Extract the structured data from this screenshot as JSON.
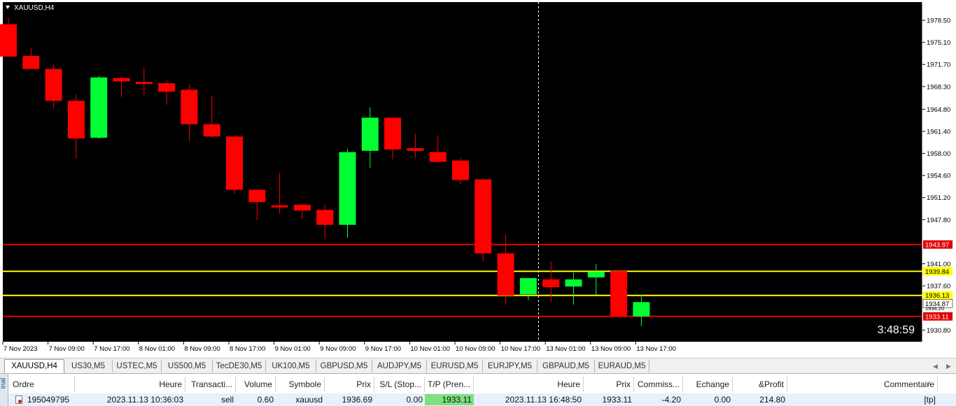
{
  "window": {
    "symbol_title": "XAUUSD,H4",
    "timer": "3:48:59"
  },
  "colors": {
    "bull": "#00ff33",
    "bear": "#ff0000",
    "background": "#000000",
    "foreground": "#ffffff",
    "level_red": "#e00000",
    "level_yellow": "#ffff00"
  },
  "chart_data": {
    "type": "candlestick",
    "y_range": [
      1929.0,
      1981.3
    ],
    "y_ticks": [
      "1978.50",
      "1975.10",
      "1971.70",
      "1968.30",
      "1964.80",
      "1961.40",
      "1958.00",
      "1954.60",
      "1951.20",
      "1947.80",
      "1941.00",
      "1937.60",
      "1930.80"
    ],
    "y_tick_values": [
      1978.5,
      1975.1,
      1971.7,
      1968.3,
      1964.8,
      1961.4,
      1958.0,
      1954.6,
      1951.2,
      1947.8,
      1941.0,
      1937.6,
      1930.8
    ],
    "x_labels": [
      "7 Nov 2023",
      "7 Nov 09:00",
      "7 Nov 17:00",
      "8 Nov 01:00",
      "8 Nov 09:00",
      "8 Nov 17:00",
      "9 Nov 01:00",
      "9 Nov 09:00",
      "9 Nov 17:00",
      "10 Nov 01:00",
      "10 Nov 09:00",
      "10 Nov 17:00",
      "13 Nov 01:00",
      "13 Nov 09:00",
      "13 Nov 17:00"
    ],
    "candles": [
      {
        "o": 1977.9,
        "h": 1978.9,
        "l": 1972.9,
        "c": 1972.9
      },
      {
        "o": 1973.0,
        "h": 1974.2,
        "l": 1971.2,
        "c": 1971.0
      },
      {
        "o": 1971.0,
        "h": 1971.7,
        "l": 1964.9,
        "c": 1966.1
      },
      {
        "o": 1966.1,
        "h": 1967.1,
        "l": 1957.2,
        "c": 1960.3
      },
      {
        "o": 1960.4,
        "h": 1970.0,
        "l": 1960.3,
        "c": 1969.7
      },
      {
        "o": 1969.6,
        "h": 1969.9,
        "l": 1966.7,
        "c": 1969.1
      },
      {
        "o": 1969.0,
        "h": 1971.1,
        "l": 1967.0,
        "c": 1968.9
      },
      {
        "o": 1968.8,
        "h": 1969.3,
        "l": 1965.5,
        "c": 1967.5
      },
      {
        "o": 1967.8,
        "h": 1968.6,
        "l": 1959.9,
        "c": 1962.5
      },
      {
        "o": 1962.5,
        "h": 1966.9,
        "l": 1960.4,
        "c": 1960.6
      },
      {
        "o": 1960.6,
        "h": 1960.7,
        "l": 1951.8,
        "c": 1952.4
      },
      {
        "o": 1952.4,
        "h": 1952.4,
        "l": 1947.7,
        "c": 1950.5
      },
      {
        "o": 1950.0,
        "h": 1955.0,
        "l": 1948.7,
        "c": 1949.7
      },
      {
        "o": 1950.1,
        "h": 1950.3,
        "l": 1947.9,
        "c": 1949.2
      },
      {
        "o": 1949.3,
        "h": 1950.1,
        "l": 1944.8,
        "c": 1947.0
      },
      {
        "o": 1947.0,
        "h": 1958.7,
        "l": 1945.0,
        "c": 1958.2
      },
      {
        "o": 1958.4,
        "h": 1965.1,
        "l": 1955.8,
        "c": 1963.5
      },
      {
        "o": 1963.5,
        "h": 1963.5,
        "l": 1957.1,
        "c": 1958.6
      },
      {
        "o": 1958.8,
        "h": 1961.0,
        "l": 1957.3,
        "c": 1958.4
      },
      {
        "o": 1958.2,
        "h": 1960.8,
        "l": 1956.6,
        "c": 1956.7
      },
      {
        "o": 1956.9,
        "h": 1957.3,
        "l": 1953.3,
        "c": 1953.9
      },
      {
        "o": 1954.0,
        "h": 1954.1,
        "l": 1941.4,
        "c": 1942.6
      },
      {
        "o": 1942.6,
        "h": 1945.5,
        "l": 1934.7,
        "c": 1936.1
      },
      {
        "o": 1936.3,
        "h": 1938.8,
        "l": 1935.4,
        "c": 1938.8
      },
      {
        "o": 1938.6,
        "h": 1941.4,
        "l": 1935.1,
        "c": 1937.4
      },
      {
        "o": 1937.5,
        "h": 1939.6,
        "l": 1934.7,
        "c": 1938.6
      },
      {
        "o": 1938.9,
        "h": 1941.0,
        "l": 1936.2,
        "c": 1939.8
      },
      {
        "o": 1939.9,
        "h": 1939.9,
        "l": 1932.8,
        "c": 1932.9
      },
      {
        "o": 1932.9,
        "h": 1936.2,
        "l": 1931.4,
        "c": 1935.1
      }
    ],
    "levels": [
      {
        "price": 1943.97,
        "label": "1943.97",
        "color": "#e00000"
      },
      {
        "price": 1939.84,
        "label": "1939.84",
        "color": "#ffff00"
      },
      {
        "price": 1936.13,
        "label": "1936.13",
        "color": "#ffff00"
      },
      {
        "price": 1932.9,
        "label": "1933.11",
        "color": "#e00000"
      }
    ],
    "ask_label": "1934.87",
    "ask_price": 1934.87,
    "bid_partial_label": "1934.20",
    "crosshair_candle_index": 23.45
  },
  "tabs": [
    "XAUUSD,H4",
    "US30,M5",
    "USTEC,M5",
    "US500,M5",
    "TecDE30,M5",
    "UK100,M5",
    "GBPUSD,M5",
    "AUDJPY,M5",
    "EURUSD,M5",
    "EURJPY,M5",
    "GBPAUD,M5",
    "EURAUD,M5"
  ],
  "terminal": {
    "side_label": "inal",
    "columns": [
      "Ordre",
      "Heure",
      "Transacti...",
      "Volume",
      "Symbole",
      "Prix",
      "S/L (Stop...",
      "T/P (Pren...",
      "Heure",
      "Prix",
      "Commiss...",
      "Echange",
      "&Profit",
      "Commentaire"
    ],
    "row": [
      "195049795",
      "2023.11.13 10:36:03",
      "sell",
      "0.60",
      "xauusd",
      "1936.69",
      "0.00",
      "1933.11",
      "2023.11.13 16:48:50",
      "1933.11",
      "-4.20",
      "0.00",
      "214.80",
      "[tp]"
    ]
  }
}
